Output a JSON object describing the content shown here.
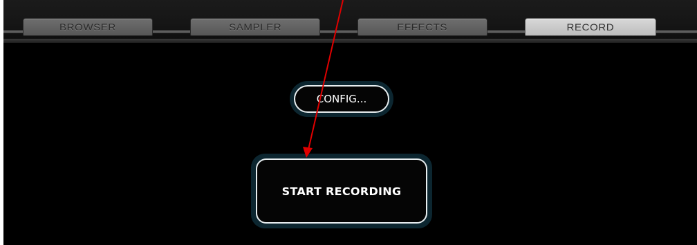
{
  "tabs": [
    {
      "label": "BROWSER",
      "active": false
    },
    {
      "label": "SAMPLER",
      "active": false
    },
    {
      "label": "EFFECTS",
      "active": false
    },
    {
      "label": "RECORD",
      "active": true
    }
  ],
  "record_panel": {
    "config_label": "CONFIG...",
    "start_recording_label": "START RECORDING"
  },
  "colors": {
    "background": "#000000",
    "tab_inactive": "#606060",
    "tab_active": "#cccccc",
    "button_border": "#e8eef0",
    "button_halo": "#0c2630",
    "annotation_arrow": "#e00000"
  },
  "annotation": {
    "type": "arrow",
    "color": "#e00000",
    "points_to": "start-recording-button"
  }
}
